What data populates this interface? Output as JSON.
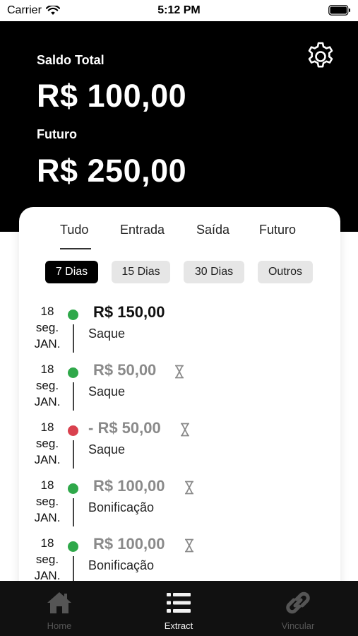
{
  "status_bar": {
    "carrier": "Carrier",
    "time": "5:12 PM"
  },
  "header": {
    "saldo_label": "Saldo Total",
    "saldo_value": "R$ 100,00",
    "futuro_label": "Futuro",
    "futuro_value": "R$ 250,00",
    "settings_icon": "gear-icon"
  },
  "tabs": [
    {
      "label": "Tudo",
      "active": true
    },
    {
      "label": "Entrada",
      "active": false
    },
    {
      "label": "Saída",
      "active": false
    },
    {
      "label": "Futuro",
      "active": false
    }
  ],
  "filters": [
    {
      "label": "7 Dias",
      "active": true
    },
    {
      "label": "15 Dias",
      "active": false
    },
    {
      "label": "30 Dias",
      "active": false
    },
    {
      "label": "Outros",
      "active": false
    }
  ],
  "colors": {
    "positive": "#2fa84a",
    "negative": "#d9414e",
    "pending_text": "#8a8a8a"
  },
  "transactions": [
    {
      "day": "18",
      "weekday": "seg.",
      "month": "JAN.",
      "amount": "R$ 150,00",
      "description": "Saque",
      "status": "positive",
      "pending": false
    },
    {
      "day": "18",
      "weekday": "seg.",
      "month": "JAN.",
      "amount": "R$ 50,00",
      "description": "Saque",
      "status": "positive",
      "pending": true
    },
    {
      "day": "18",
      "weekday": "seg.",
      "month": "JAN.",
      "amount": "- R$ 50,00",
      "description": "Saque",
      "status": "negative",
      "pending": true
    },
    {
      "day": "18",
      "weekday": "seg.",
      "month": "JAN.",
      "amount": "R$ 100,00",
      "description": "Bonificação",
      "status": "positive",
      "pending": true
    },
    {
      "day": "18",
      "weekday": "seg.",
      "month": "JAN.",
      "amount": "R$ 100,00",
      "description": "Bonificação",
      "status": "positive",
      "pending": true
    }
  ],
  "tabbar": [
    {
      "label": "Home",
      "icon": "home-icon",
      "active": false
    },
    {
      "label": "Extract",
      "icon": "list-icon",
      "active": true
    },
    {
      "label": "Vincular",
      "icon": "link-icon",
      "active": false
    }
  ]
}
